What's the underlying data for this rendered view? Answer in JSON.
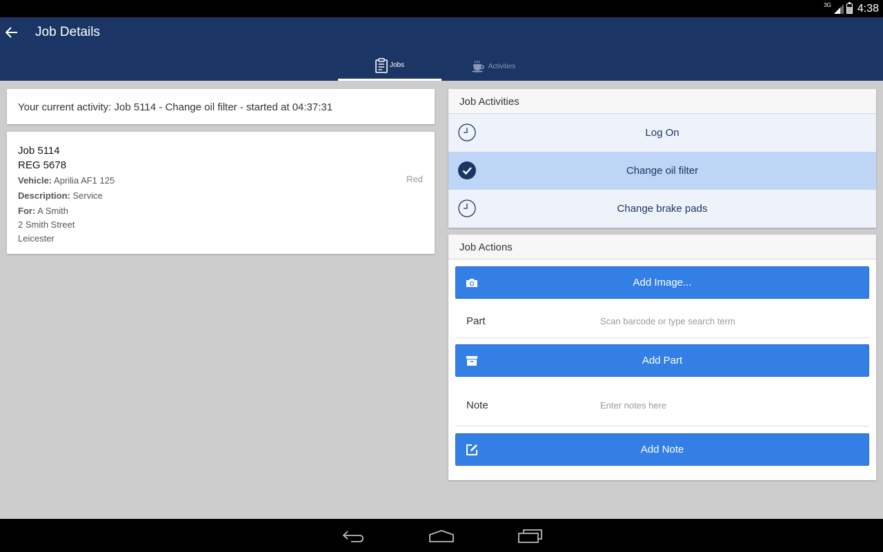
{
  "status_bar": {
    "network": "3G",
    "time": "4:38"
  },
  "app_bar": {
    "title": "Job Details",
    "tabs": [
      {
        "label": "Jobs",
        "icon": "clipboard-icon",
        "active": true
      },
      {
        "label": "Activities",
        "icon": "coffee-cup-icon",
        "active": false
      }
    ]
  },
  "current_activity": {
    "text": "Your current activity: Job 5114 - Change oil filter - started at 04:37:31"
  },
  "job": {
    "number": "Job 5114",
    "reg": "REG 5678",
    "vehicle_label": "Vehicle:",
    "vehicle": "Aprilia AF1 125",
    "color": "Red",
    "description_label": "Description:",
    "description": "Service",
    "for_label": "For:",
    "customer": "A Smith",
    "address_line1": "2 Smith Street",
    "address_line2": "Leicester"
  },
  "job_activities": {
    "title": "Job Activities",
    "items": [
      {
        "label": "Log On",
        "icon": "clock-icon",
        "selected": false
      },
      {
        "label": "Change oil filter",
        "icon": "check-circle-icon",
        "selected": true
      },
      {
        "label": "Change brake pads",
        "icon": "clock-icon",
        "selected": false
      }
    ]
  },
  "job_actions": {
    "title": "Job Actions",
    "add_image_label": "Add Image...",
    "part_label": "Part",
    "part_placeholder": "Scan barcode or type search term",
    "part_value": "",
    "add_part_label": "Add Part",
    "note_label": "Note",
    "note_placeholder": "Enter notes here",
    "note_value": "",
    "add_note_label": "Add Note"
  },
  "colors": {
    "app_bar": "#1b3565",
    "action_button": "#337fe6",
    "selected_activity": "#bfd5f6",
    "activity_row": "#eef3fb",
    "background": "#cdcdcd"
  }
}
